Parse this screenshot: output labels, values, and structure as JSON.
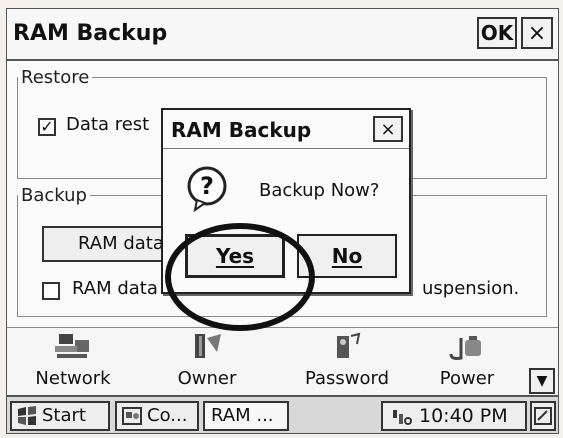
{
  "window": {
    "title": "RAM Backup",
    "ok_label": "OK",
    "close_label": "×"
  },
  "restore": {
    "group_label": "Restore",
    "checkbox_label": "Data rest",
    "checked": true
  },
  "backup": {
    "group_label": "Backup",
    "button_label": "RAM data",
    "checkbox_label": "RAM data",
    "checkbox_tail": "uspension.",
    "checked": false
  },
  "control_panel": {
    "items": [
      {
        "label": "Network",
        "icon": "network-icon"
      },
      {
        "label": "Owner",
        "icon": "owner-icon"
      },
      {
        "label": "Password",
        "icon": "password-icon"
      },
      {
        "label": "Power",
        "icon": "power-icon"
      }
    ],
    "scroll_icon": "chevron-down-icon"
  },
  "taskbar": {
    "start_label": "Start",
    "task1_label": "Co...",
    "task2_label": "RAM ...",
    "clock": "10:40 PM"
  },
  "dialog": {
    "title": "RAM Backup",
    "close_label": "×",
    "message": "Backup Now?",
    "yes_label": "Yes",
    "no_label": "No",
    "icon": "question-icon"
  }
}
